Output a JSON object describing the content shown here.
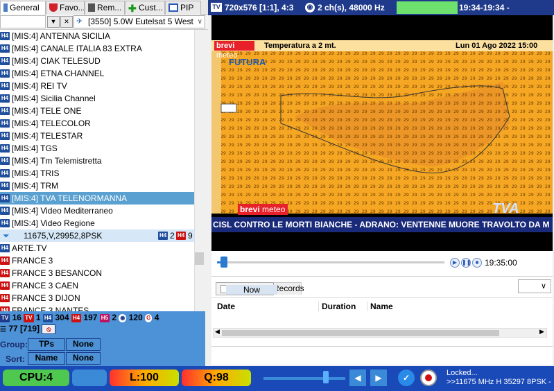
{
  "tabs": [
    {
      "label": "General",
      "icon": "general-icon"
    },
    {
      "label": "Favo...",
      "icon": "shield-favorites-icon"
    },
    {
      "label": "Rem...",
      "icon": "remote-icon"
    },
    {
      "label": "Cust...",
      "icon": "plus-icon"
    },
    {
      "label": "PIP",
      "icon": "pip-icon"
    }
  ],
  "satellite": {
    "selected": "[3550]  5.0W  Eutelsat 5 West"
  },
  "channels": [
    {
      "badge": "H4",
      "name": "[MIS:4] ANTENNA SICILIA"
    },
    {
      "badge": "H4",
      "name": "[MIS:4] CANALE ITALIA 83 EXTRA"
    },
    {
      "badge": "H4",
      "name": "[MIS:4] CIAK TELESUD"
    },
    {
      "badge": "H4",
      "name": "[MIS:4] ETNA CHANNEL"
    },
    {
      "badge": "H4",
      "name": "[MIS:4] REI TV"
    },
    {
      "badge": "H4",
      "name": "[MIS:4] Sicilia Channel"
    },
    {
      "badge": "H4",
      "name": "[MIS:4] TELE ONE"
    },
    {
      "badge": "H4",
      "name": "[MIS:4] TELECOLOR"
    },
    {
      "badge": "H4",
      "name": "[MIS:4] TELESTAR"
    },
    {
      "badge": "H4",
      "name": "[MIS:4] TGS"
    },
    {
      "badge": "H4",
      "name": "[MIS:4] Tm Telemistretta"
    },
    {
      "badge": "H4",
      "name": "[MIS:4] TRIS"
    },
    {
      "badge": "H4",
      "name": "[MIS:4] TRM"
    },
    {
      "badge": "H4",
      "name": "[MIS:4] TVA TELENORMANNA",
      "selected": true
    },
    {
      "badge": "H4",
      "name": "[MIS:4] Video Mediterraneo"
    },
    {
      "badge": "H4",
      "name": "[MIS:4] Video Regione"
    }
  ],
  "transponder": {
    "label": "11675,V,29952,8PSK",
    "h4_count": "2",
    "hd_count": "9"
  },
  "channels2": [
    {
      "badge": "H4",
      "name": "ARTE.TV"
    },
    {
      "badge": "HD",
      "name": "FRANCE 3"
    },
    {
      "badge": "HD",
      "name": "FRANCE 3 BESANCON"
    },
    {
      "badge": "HD",
      "name": "FRANCE 3 CAEN"
    },
    {
      "badge": "HD",
      "name": "FRANCE 3 DIJON"
    },
    {
      "badge": "HD",
      "name": "FRANCE 3 NANTES"
    }
  ],
  "stats": {
    "tv_count": "16",
    "radio_count": "1",
    "h4_count": "304",
    "hd_count": "197",
    "h5_count": "2",
    "global_count": "120",
    "g_count": "4",
    "list_count": "77 [719]",
    "group_label": "Group:",
    "group_a": "TPs",
    "group_b": "None",
    "sort_label": "Sort:",
    "sort_a": "Name",
    "sort_b": "None"
  },
  "video_info": {
    "resolution": "720x576 [1:1], 4:3",
    "audio": "2 ch(s), 48000 Hz",
    "time": "19:34-19:34 -"
  },
  "broadcast": {
    "brand1": "brevi",
    "brand2": "meteo",
    "map_title": "Temperatura a 2 mt.",
    "date": "Lun  01 Ago 2022   15:00",
    "futura": "FUTURA",
    "ticker": "CISL CONTRO LE MORTI BIANCHE   -   ADRANO: VENTENNE MUORE TRAVOLTO DA M"
  },
  "progress": {
    "time": "19:35:00",
    "fraction": 0.02
  },
  "epg": {
    "tab_now": "Now",
    "tab_records": "Records",
    "col_date": "Date",
    "col_duration": "Duration",
    "col_name": "Name"
  },
  "statusbar": {
    "cpu": "CPU:4",
    "level": "L:100",
    "quality": "Q:98",
    "locked": "Locked...",
    "freq": ">>11675 MHz H 35297 8PSK -"
  }
}
